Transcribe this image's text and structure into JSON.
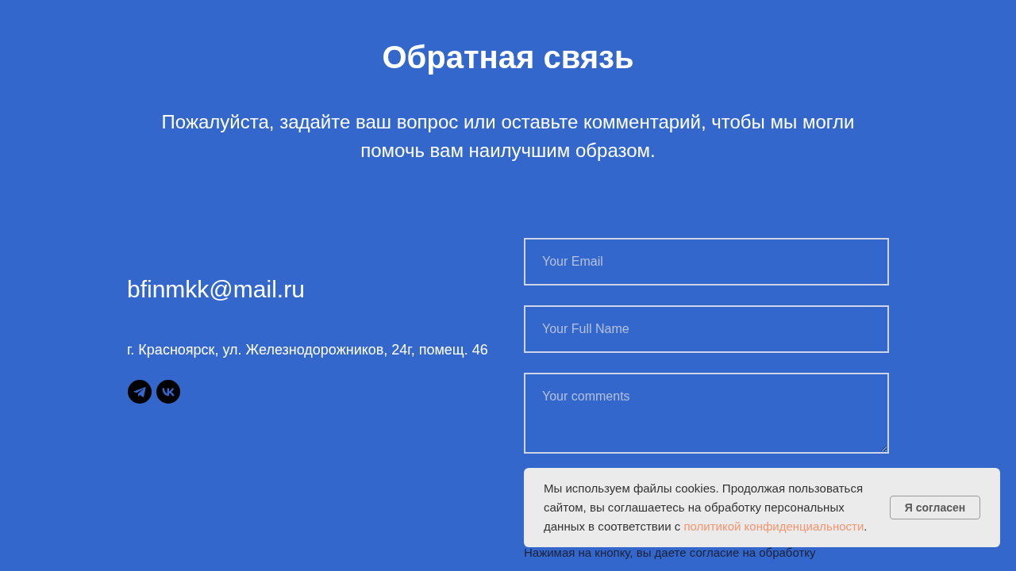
{
  "header": {
    "title": "Обратная связь",
    "subtitle": "Пожалуйста, задайте ваш вопрос или оставьте комментарий, чтобы мы могли помочь вам наилучшим образом."
  },
  "contacts": {
    "email": "bfinmkk@mail.ru",
    "address": "г. Красноярск, ул. Железнодорожников, 24г, помещ. 46"
  },
  "form": {
    "fields": [
      {
        "kind": "input",
        "placeholder": "Your Email"
      },
      {
        "kind": "input",
        "placeholder": "Your Full Name"
      },
      {
        "kind": "textarea",
        "placeholder": "Your comments"
      }
    ],
    "consent_text": "Нажимая на кнопку, вы даете согласие на обработку"
  },
  "cookie_banner": {
    "text": "Мы используем файлы cookies. Продолжая пользоваться сайтом, вы соглашаетесь на обработку персональных данных в соответствии с",
    "link": "политикой конфиденциальности",
    "text_end": ".",
    "button": "Я согласен"
  }
}
